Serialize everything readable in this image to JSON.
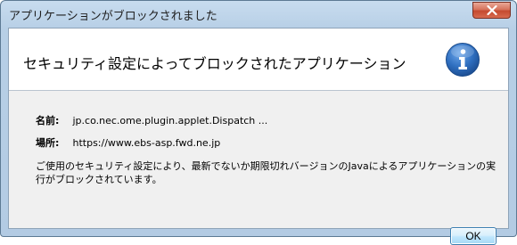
{
  "window": {
    "title": "アプリケーションがブロックされました",
    "close_icon": "close-icon"
  },
  "header": {
    "text": "セキュリティ設定によってブロックされたアプリケーション",
    "icon": "info-icon"
  },
  "details": {
    "name_label": "名前:",
    "name_value": "jp.co.nec.ome.plugin.applet.Dispatch ...",
    "location_label": "場所:",
    "location_value": "https://www.ebs-asp.fwd.ne.jp",
    "message": "ご使用のセキュリティ設定により、最新でないか期限切れバージョンのJavaによるアプリケーションの実行がブロックされています。"
  },
  "buttons": {
    "ok_label": "OK"
  },
  "colors": {
    "title_bar": "#b7cfe6",
    "close_button": "#c54a2f",
    "info_icon": "#2f6fc0"
  }
}
